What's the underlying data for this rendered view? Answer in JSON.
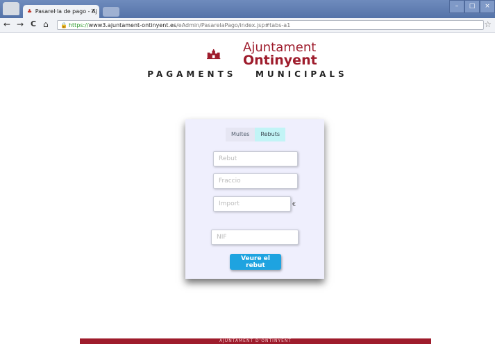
{
  "browser": {
    "tab_title": "Pasarel·la de pago - Aj",
    "tab_close": "×",
    "back": "←",
    "forward": "→",
    "reload": "C",
    "home": "⌂",
    "url_scheme": "https://",
    "url_host": "www3.ajuntament-ontinyent.es",
    "url_path": "/eAdmin/PasarelaPago/index.jsp#tabs-a1",
    "win_minimize": "–",
    "win_maximize": "□",
    "win_close": "×",
    "star": "☆"
  },
  "header": {
    "logo_line1": "Ajuntament",
    "logo_line2": "Ontinyent",
    "subtitle": "PAGAMENTS   MUNICIPALS"
  },
  "form": {
    "tabs": [
      {
        "label": "Multes",
        "active": false
      },
      {
        "label": "Rebuts",
        "active": true
      }
    ],
    "rebut_placeholder": "Rebut",
    "fraccio_placeholder": "Fraccio",
    "import_placeholder": "Import",
    "currency": "€",
    "nif_placeholder": "NIF",
    "submit_label": "Veure el rebut"
  },
  "footer": {
    "text": "AJUNTAMENT D'ONTINYENT"
  },
  "colors": {
    "brand": "#9e1c2c",
    "button": "#1ea3e0",
    "active_tab": "#c2f4f6",
    "card_bg": "#efeffd"
  }
}
